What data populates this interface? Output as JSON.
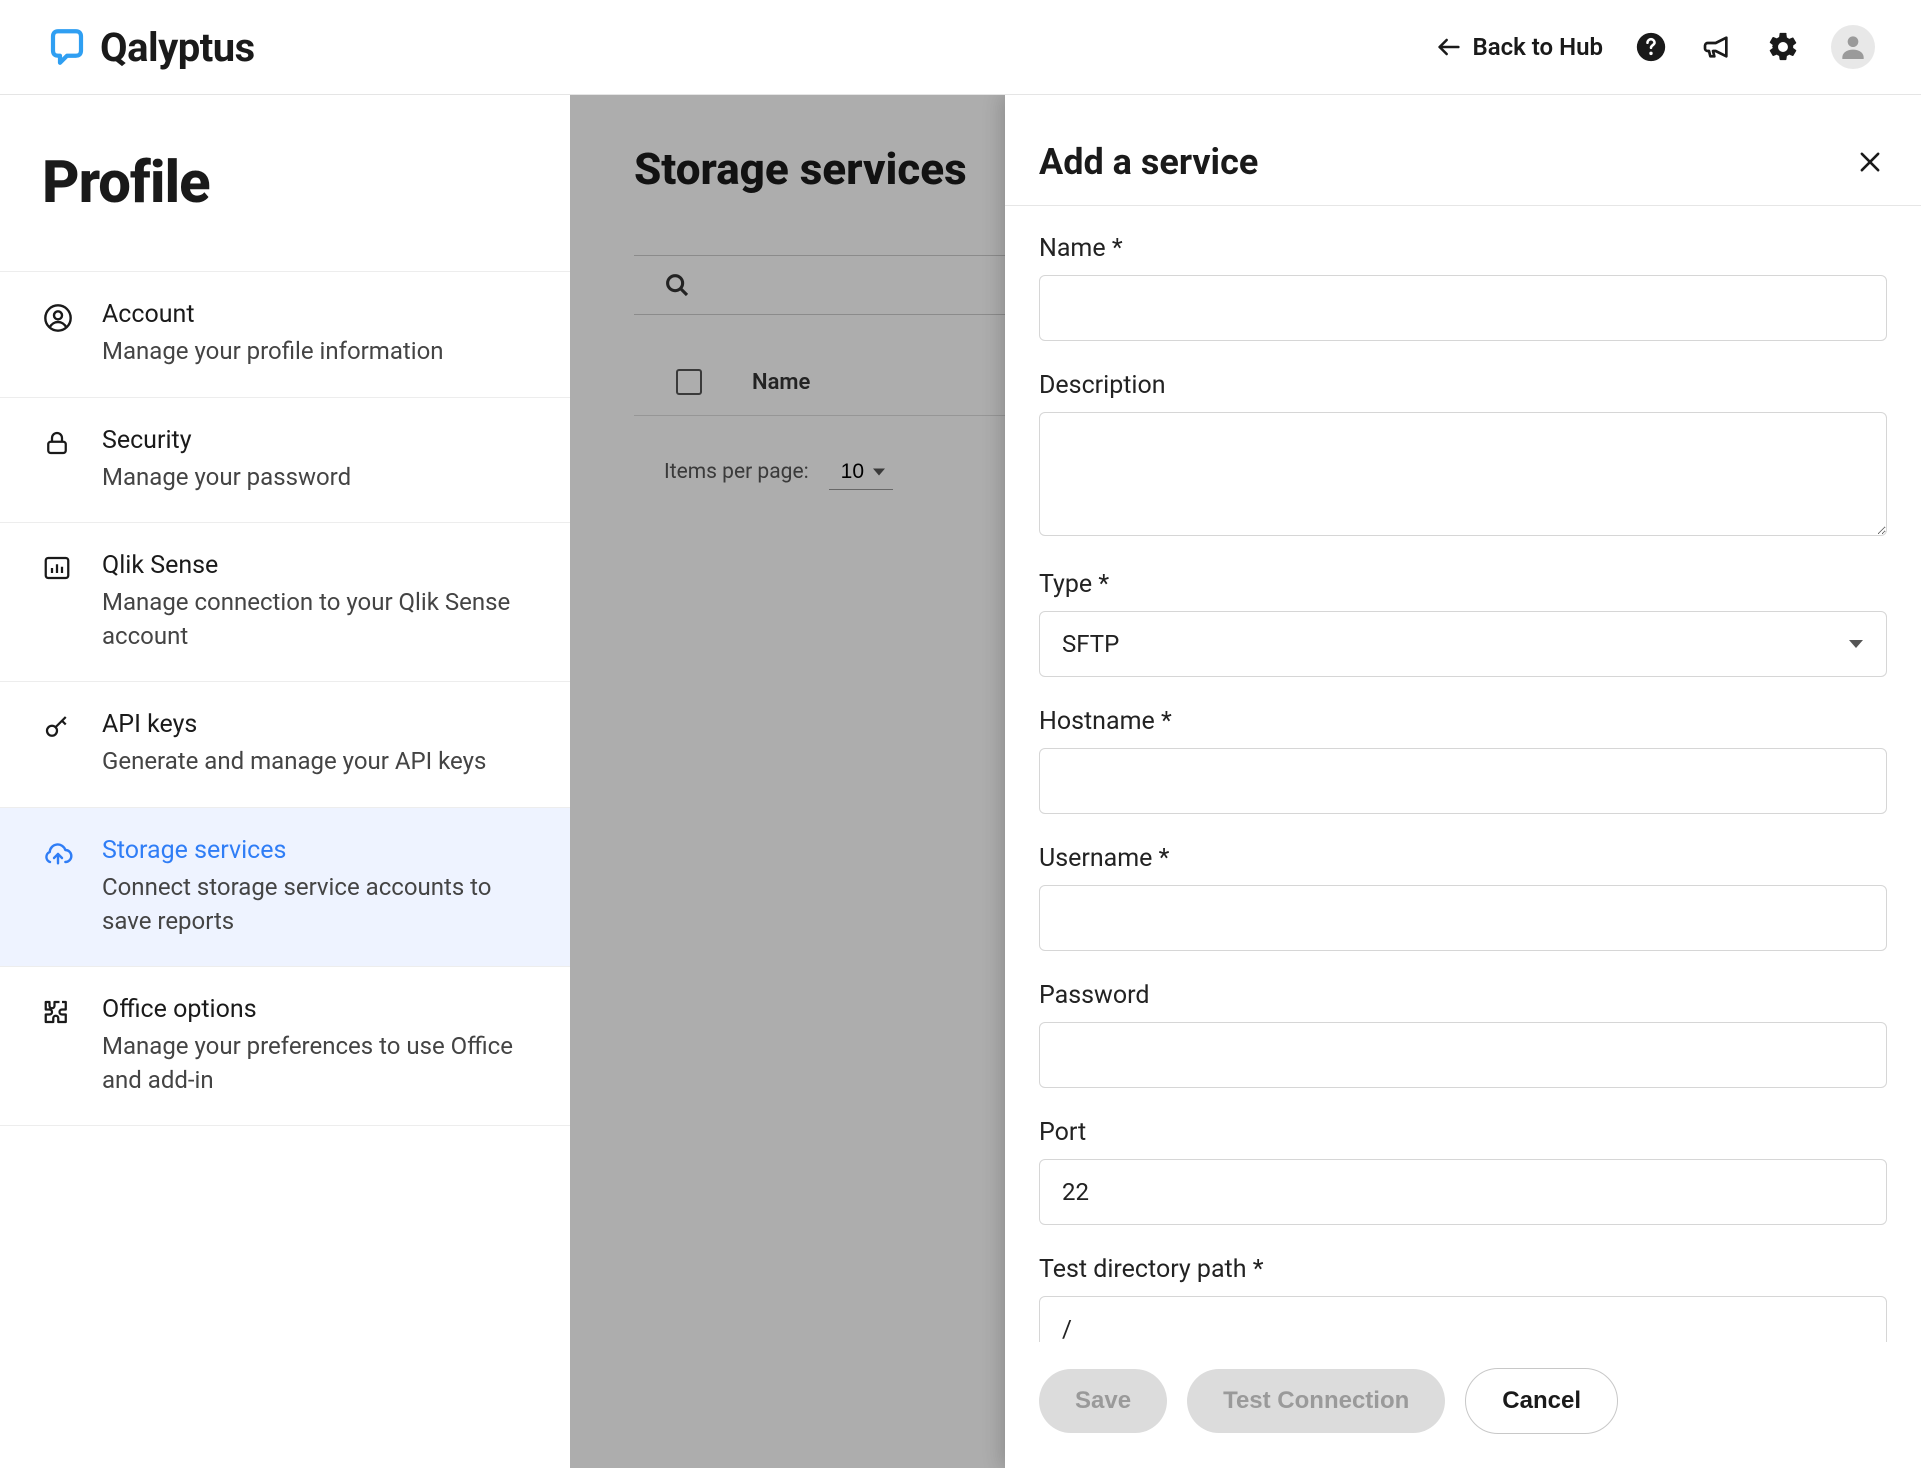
{
  "brand": {
    "name": "Qalyptus",
    "accent": "#2f7df6"
  },
  "header": {
    "back_label": "Back to Hub"
  },
  "sidebar": {
    "title": "Profile",
    "items": [
      {
        "title": "Account",
        "desc": "Manage your profile information"
      },
      {
        "title": "Security",
        "desc": "Manage your password"
      },
      {
        "title": "Qlik Sense",
        "desc": "Manage connection to your Qlik Sense account"
      },
      {
        "title": "API keys",
        "desc": "Generate and manage your API keys"
      },
      {
        "title": "Storage services",
        "desc": "Connect storage service accounts to save reports"
      },
      {
        "title": "Office options",
        "desc": "Manage your preferences to use Office and add-in"
      }
    ]
  },
  "content": {
    "title": "Storage services",
    "column_name": "Name",
    "items_per_page_label": "Items per page:",
    "items_per_page_value": "10"
  },
  "panel": {
    "title": "Add a service",
    "fields": {
      "name": {
        "label": "Name *",
        "value": ""
      },
      "description": {
        "label": "Description",
        "value": ""
      },
      "type": {
        "label": "Type *",
        "value": "SFTP"
      },
      "hostname": {
        "label": "Hostname *",
        "value": ""
      },
      "username": {
        "label": "Username *",
        "value": ""
      },
      "password": {
        "label": "Password",
        "value": ""
      },
      "port": {
        "label": "Port",
        "value": "22"
      },
      "testpath": {
        "label": "Test directory path *",
        "value": "/"
      }
    },
    "buttons": {
      "save": "Save",
      "test": "Test Connection",
      "cancel": "Cancel"
    }
  }
}
